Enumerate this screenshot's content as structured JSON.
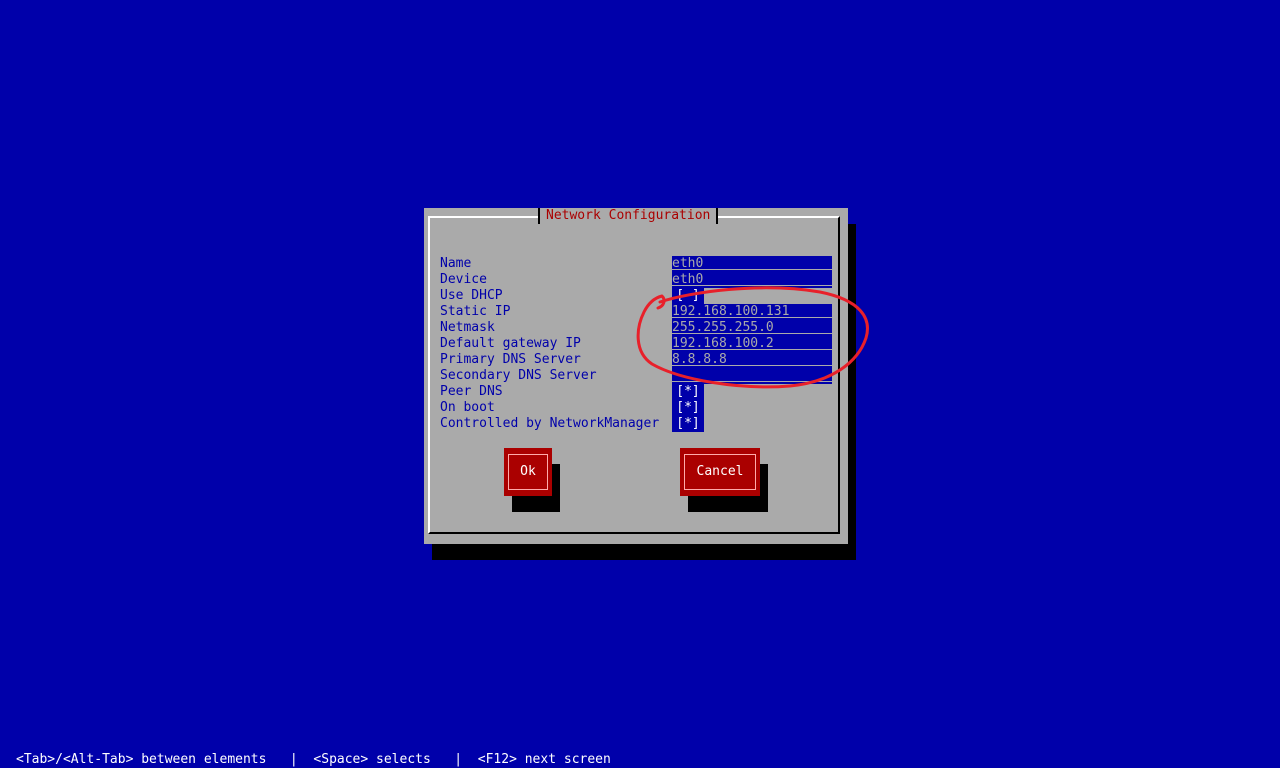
{
  "dialog": {
    "title": "Network Configuration"
  },
  "fields": [
    {
      "label": "Name",
      "value": "eth0"
    },
    {
      "label": "Device",
      "value": "eth0"
    },
    {
      "label": "Use DHCP",
      "value": "[ ]"
    },
    {
      "label": "Static IP",
      "value": "192.168.100.131"
    },
    {
      "label": "Netmask",
      "value": "255.255.255.0"
    },
    {
      "label": "Default gateway IP",
      "value": "192.168.100.2"
    },
    {
      "label": "Primary DNS Server",
      "value": "8.8.8.8"
    },
    {
      "label": "Secondary DNS Server",
      "value": ""
    },
    {
      "label": "Peer DNS",
      "value": "[*]"
    },
    {
      "label": "On boot",
      "value": "[*]"
    },
    {
      "label": "Controlled by NetworkManager",
      "value": "[*]"
    }
  ],
  "buttons": {
    "ok": "Ok",
    "cancel": "Cancel"
  },
  "statusbar": {
    "text": "<Tab>/<Alt-Tab> between elements   |  <Space> selects   |  <F12> next screen"
  },
  "colors": {
    "background": "#0000aa",
    "dialog": "#aaaaaa",
    "title": "#aa0000",
    "button": "#aa0000",
    "annotation": "#e8202a"
  }
}
